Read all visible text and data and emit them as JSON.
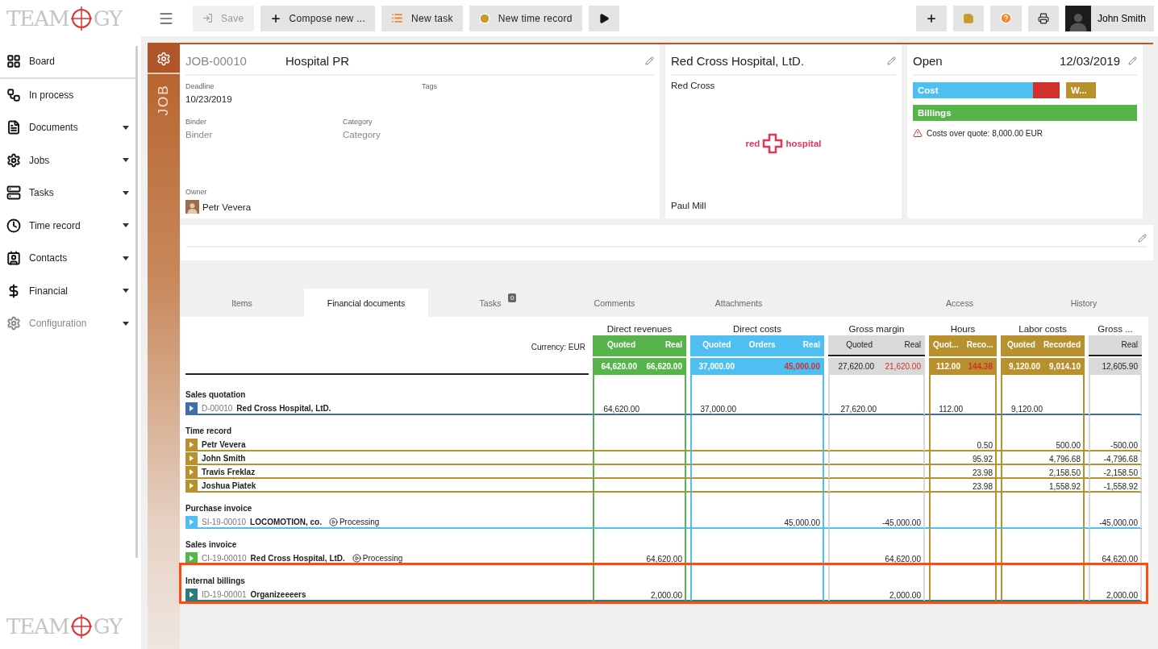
{
  "logo": {
    "left": "TEAM",
    "right": "GY"
  },
  "bottom_logo": {
    "left": "TEAM",
    "right": "GY"
  },
  "toolbar": {
    "buttons": [
      {
        "kind": "save",
        "label": "Save",
        "disabled": true
      },
      {
        "kind": "compose",
        "label": "Compose new ...",
        "disabled": false
      },
      {
        "kind": "task",
        "label": "New task",
        "disabled": false
      },
      {
        "kind": "time",
        "label": "New time record",
        "disabled": false
      },
      {
        "kind": "play",
        "disabled": false
      }
    ],
    "right_buttons": [
      {
        "kind": "plus"
      },
      {
        "kind": "note"
      },
      {
        "kind": "help"
      },
      {
        "kind": "print"
      }
    ],
    "user": {
      "name": "John Smith"
    }
  },
  "sidebar": {
    "items": [
      {
        "kind": "board",
        "label": "Board",
        "expandable": false,
        "disabled": false
      },
      {
        "kind": "process",
        "label": "In process",
        "expandable": false,
        "disabled": false
      },
      {
        "kind": "documents",
        "label": "Documents",
        "expandable": true,
        "disabled": false
      },
      {
        "kind": "jobs",
        "label": "Jobs",
        "expandable": true,
        "disabled": false
      },
      {
        "kind": "tasks",
        "label": "Tasks",
        "expandable": true,
        "disabled": false
      },
      {
        "kind": "time",
        "label": "Time record",
        "expandable": true,
        "disabled": false
      },
      {
        "kind": "contacts",
        "label": "Contacts",
        "expandable": true,
        "disabled": false
      },
      {
        "kind": "financial",
        "label": "Financial",
        "expandable": true,
        "disabled": false
      },
      {
        "kind": "config",
        "label": "Configuration",
        "expandable": true,
        "disabled": true
      }
    ]
  },
  "job": {
    "stripe_label": "JOB",
    "number": "JOB-00010",
    "title": "Hospital PR",
    "fields": [
      {
        "label": "Deadline",
        "value": "10/23/2019"
      },
      {
        "label": "Tags"
      },
      {
        "label": "Binder",
        "placeholder": "Binder"
      },
      {
        "label": "Category",
        "placeholder": "Category"
      }
    ],
    "owner": {
      "label": "Owner",
      "name": "Petr Vevera"
    }
  },
  "customer": {
    "name": "Red Cross Hospital, LtD.",
    "short_name": "Red Cross",
    "logo": {
      "left": "red",
      "right": "hospital"
    },
    "contact": "Paul Mill"
  },
  "status": {
    "state": "Open",
    "date": "12/03/2019",
    "bars": [
      {
        "kind": "wide",
        "label": "Cost",
        "level": 0.82,
        "color": "#4fbff2"
      },
      {
        "kind": "narrow",
        "label": "W...",
        "level": 1,
        "color": "#b8902e"
      },
      {
        "kind": "full",
        "label": "Billings",
        "level": 1,
        "color": "#55b34a"
      }
    ],
    "warning": "Costs over quote: 8,000.00 EUR"
  },
  "tabs": [
    {
      "label": "Items",
      "selected": false
    },
    {
      "label": "Financial documents",
      "selected": true
    },
    {
      "label": "Tasks",
      "badge": "0",
      "selected": false
    },
    {
      "label": "Comments",
      "selected": false
    },
    {
      "label": "Attachments",
      "selected": false
    },
    {
      "label": "Access",
      "selected": false
    },
    {
      "label": "History",
      "selected": false
    }
  ],
  "table": {
    "currency": "Currency: EUR",
    "groups": [
      {
        "title": "Direct revenues",
        "kind": "revenues",
        "color": "#56b44a",
        "columns": [
          {
            "kind": "quoted",
            "label": "Quoted",
            "total": "64,620.00",
            "alert": false
          },
          {
            "kind": "real",
            "label": "Real",
            "total": "66,620.00",
            "alert": false
          }
        ]
      },
      {
        "title": "Direct costs",
        "kind": "costs",
        "color": "#4fbff2",
        "columns": [
          {
            "kind": "quoted",
            "label": "Quoted",
            "total": "37,000.00",
            "alert": false
          },
          {
            "kind": "orders",
            "label": "Orders"
          },
          {
            "kind": "real",
            "label": "Real",
            "total": "45,000.00",
            "alert": true
          }
        ]
      },
      {
        "title": "Gross margin",
        "kind": "margin",
        "color": "#d9d9d9",
        "columns": [
          {
            "kind": "quoted",
            "label": "Quoted",
            "total": "27,620.00",
            "alert": false
          },
          {
            "kind": "real",
            "label": "Real",
            "total": "21,620.00",
            "alert": true
          }
        ]
      },
      {
        "title": "Hours",
        "kind": "hours",
        "color": "#b8902e",
        "columns": [
          {
            "kind": "quoted",
            "label": "Quot...",
            "total": "112.00",
            "alert": false
          },
          {
            "kind": "recorded",
            "label": "Reco...",
            "total": "144.38",
            "alert": true
          }
        ]
      },
      {
        "title": "Labor costs",
        "kind": "labor",
        "color": "#b8902e",
        "columns": [
          {
            "kind": "quoted",
            "label": "Quoted",
            "total": "9,120.00",
            "alert": false
          },
          {
            "kind": "recorded",
            "label": "Recorded",
            "total": "9,014.10",
            "alert": false
          }
        ]
      },
      {
        "title": "Gross ...",
        "kind": "gross",
        "color": "#d9d9d9",
        "columns": [
          {
            "kind": "real",
            "label": "Real",
            "total": "12,605.90",
            "alert": false
          }
        ]
      }
    ],
    "sections": [
      {
        "title": "Sales quotation",
        "color": "#3f6fad",
        "highlighted": false,
        "rows": [
          {
            "id": "D-00010",
            "name": "Red Cross Hospital, LtD.",
            "values": {
              "revenues": {
                "quoted": "64,620.00"
              },
              "costs": {
                "quoted": "37,000.00"
              },
              "margin": {
                "quoted": "27,620.00"
              },
              "hours": {
                "quoted": "112.00"
              },
              "labor": {
                "quoted": "9,120.00"
              }
            }
          }
        ]
      },
      {
        "title": "Time record",
        "color": "#b8902e",
        "highlighted": false,
        "rows": [
          {
            "name": "Petr Vevera",
            "values": {
              "hours": {
                "recorded": "0.50"
              },
              "labor": {
                "recorded": "500.00"
              },
              "gross": {
                "real": "-500.00"
              }
            }
          },
          {
            "name": "John Smith",
            "values": {
              "hours": {
                "recorded": "95.92"
              },
              "labor": {
                "recorded": "4,796.68"
              },
              "gross": {
                "real": "-4,796.68"
              }
            }
          },
          {
            "name": "Travis Freklaz",
            "values": {
              "hours": {
                "recorded": "23.98"
              },
              "labor": {
                "recorded": "2,158.50"
              },
              "gross": {
                "real": "-2,158.50"
              }
            }
          },
          {
            "name": "Joshua Piatek",
            "values": {
              "hours": {
                "recorded": "23.98"
              },
              "labor": {
                "recorded": "1,558.92"
              },
              "gross": {
                "real": "-1,558.92"
              }
            }
          }
        ]
      },
      {
        "title": "Purchase invoice",
        "color": "#4fbff2",
        "highlighted": false,
        "rows": [
          {
            "id": "SI-19-00010",
            "name": "LOCOMOTION, co.",
            "status": "Processing",
            "values": {
              "costs": {
                "real": "45,000.00"
              },
              "margin": {
                "real": "-45,000.00"
              },
              "gross": {
                "real": "-45,000.00"
              }
            }
          }
        ]
      },
      {
        "title": "Sales invoice",
        "color": "#56b44a",
        "highlighted": false,
        "rows": [
          {
            "id": "CI-19-00010",
            "name": "Red Cross Hospital, LtD.",
            "status": "Processing",
            "values": {
              "revenues": {
                "real": "64,620.00"
              },
              "margin": {
                "real": "64,620.00"
              },
              "gross": {
                "real": "64,620.00"
              }
            }
          }
        ]
      },
      {
        "title": "Internal billings",
        "color": "#2e7a7c",
        "highlighted": true,
        "rows": [
          {
            "id": "ID-19-00001",
            "name": "Organizeeeers",
            "values": {
              "revenues": {
                "real": "2,000.00"
              },
              "margin": {
                "real": "2,000.00"
              },
              "gross": {
                "real": "2,000.00"
              }
            }
          }
        ]
      }
    ]
  }
}
